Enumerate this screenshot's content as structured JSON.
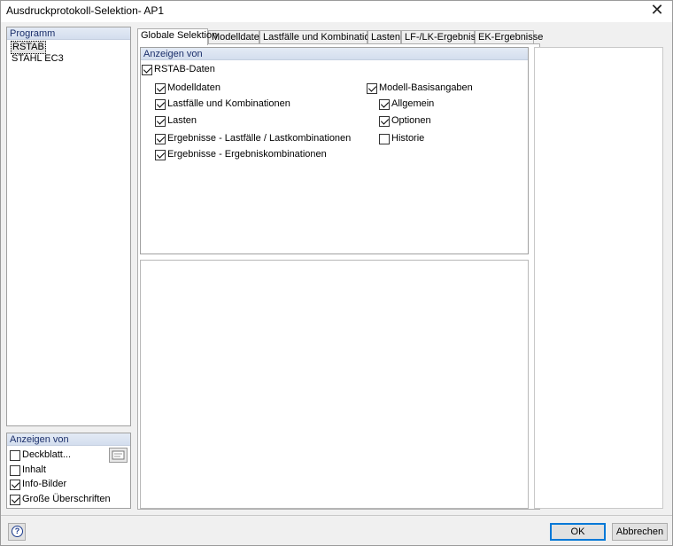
{
  "window": {
    "title": "Ausdruckprotokoll-Selektion- AP1"
  },
  "programm": {
    "header": "Programm",
    "items": [
      "RSTAB",
      "STAHL EC3"
    ]
  },
  "anzeigen_left": {
    "header": "Anzeigen von",
    "items": [
      {
        "label": "Deckblatt...",
        "checked": false
      },
      {
        "label": "Inhalt",
        "checked": false
      },
      {
        "label": "Info-Bilder",
        "checked": true
      },
      {
        "label": "Große Überschriften",
        "checked": true
      }
    ]
  },
  "tabs": [
    "Globale Selektion",
    "Modelldaten",
    "Lastfälle und Kombinationen",
    "Lasten",
    "LF-/LK-Ergebnisse",
    "EK-Ergebnisse"
  ],
  "anzeigen_main": {
    "header": "Anzeigen von",
    "root": {
      "label": "RSTAB-Daten",
      "checked": true
    },
    "left_col": [
      {
        "label": "Modelldaten",
        "checked": true
      },
      {
        "label": "Lastfälle und Kombinationen",
        "checked": true
      },
      {
        "label": "Lasten",
        "checked": true
      },
      {
        "label": "Ergebnisse - Lastfälle / Lastkombinationen",
        "checked": true
      },
      {
        "label": "Ergebnisse - Ergebniskombinationen",
        "checked": true
      }
    ],
    "right_root": {
      "label": "Modell-Basisangaben",
      "checked": true
    },
    "right_col": [
      {
        "label": "Allgemein",
        "checked": true
      },
      {
        "label": "Optionen",
        "checked": true
      },
      {
        "label": "Historie",
        "checked": false
      }
    ]
  },
  "buttons": {
    "ok": "OK",
    "cancel": "Abbrechen",
    "help": "?"
  },
  "icons": {
    "close": "close-icon",
    "help": "help-icon",
    "edit": "edit-page-icon"
  }
}
